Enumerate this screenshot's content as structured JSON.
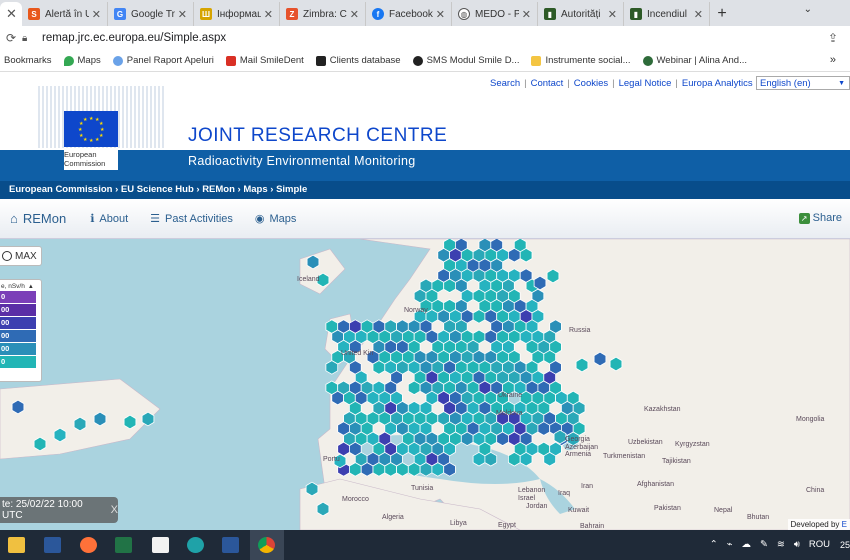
{
  "browser": {
    "tabs": [
      {
        "label": "",
        "favicon": "x-close",
        "color": "#ffffff"
      },
      {
        "label": "Alertă în U",
        "favicon": "s-icon",
        "color": "#e8581c"
      },
      {
        "label": "Google Tra",
        "favicon": "translate-icon",
        "color": "#4285f4"
      },
      {
        "label": "Інформаці",
        "favicon": "trident-icon",
        "color": "#d6a400"
      },
      {
        "label": "Zimbra: Co",
        "favicon": "zimbra-icon",
        "color": "#e6522c"
      },
      {
        "label": "Facebook",
        "favicon": "facebook-icon",
        "color": "#1877f2"
      },
      {
        "label": "MEDO - Pr",
        "favicon": "globe-icon",
        "color": "#555555"
      },
      {
        "label": "Autorități",
        "favicon": "flag-icon",
        "color": "#2d5a27"
      },
      {
        "label": "Incendiul",
        "favicon": "flag-icon",
        "color": "#2d5a27"
      }
    ],
    "new_tab": "+",
    "url": "remap.jrc.ec.europa.eu/Simple.aspx",
    "bookmarks": [
      {
        "label": "Bookmarks",
        "icon": "",
        "color": ""
      },
      {
        "label": "Maps",
        "icon": "maps-icon",
        "color": "#34a853"
      },
      {
        "label": "Panel Raport Apeluri",
        "icon": "cloud-icon",
        "color": "#6aa2e8"
      },
      {
        "label": "Mail SmileDent",
        "icon": "mail-icon",
        "color": "#d93025"
      },
      {
        "label": "Clients database",
        "icon": "y-icon",
        "color": "#222222"
      },
      {
        "label": "SMS Modul Smile D...",
        "icon": "sms-icon",
        "color": "#222222"
      },
      {
        "label": "Instrumente social...",
        "icon": "folder-icon",
        "color": "#f4c542"
      },
      {
        "label": "Webinar | Alina And...",
        "icon": "t-icon",
        "color": "#2e6b3a"
      }
    ],
    "bookmarks_more": "»"
  },
  "header": {
    "links": [
      "Search",
      "Contact",
      "Cookies",
      "Legal Notice",
      "Europa Analytics"
    ],
    "language": "English (en)",
    "ec_line1": "European",
    "ec_line2": "Commission",
    "title": "JOINT RESEARCH CENTRE",
    "subtitle": "Radioactivity Environmental Monitoring",
    "breadcrumb": "European Commission › EU Science Hub › REMon › Maps › Simple"
  },
  "nav": {
    "brand": "REMon",
    "about": "About",
    "past": "Past Activities",
    "maps": "Maps",
    "share": "Share"
  },
  "map": {
    "max_label": "MAX",
    "legend_title": "e, nSv/h",
    "legend_rows": [
      {
        "label": "0",
        "color": "#7b3fb8"
      },
      {
        "label": "00",
        "color": "#5a2ea6"
      },
      {
        "label": "00",
        "color": "#3c3fb0"
      },
      {
        "label": "00",
        "color": "#2f6bb5"
      },
      {
        "label": "00",
        "color": "#2a8fb8"
      },
      {
        "label": "0",
        "color": "#22b5b5"
      }
    ],
    "date_label": "te: 25/02/22 10:00 UTC",
    "date_close": "X",
    "developed_by": "Developed by",
    "developed_by_suffix": "E",
    "labels": {
      "iceland": "Iceland",
      "russia": "Russia",
      "kazakhstan": "Kazakhstan",
      "mongolia": "Mongolia",
      "uzbekistan": "Uzbekistan",
      "kyrgyzstan": "Kyrgyzstan",
      "turkmenistan": "Turkmenistan",
      "tajikistan": "Tajikistan",
      "afghanistan": "Afghanistan",
      "china": "China",
      "pakistan": "Pakistan",
      "nepal": "Nepal",
      "bhutan": "Bhutan",
      "iran": "Iran",
      "iraq": "Iraq",
      "kuwait": "Kuwait",
      "bahrain": "Bahrain",
      "jordan": "Jordan",
      "israel": "Israel",
      "lebanon": "Lebanon",
      "egypt": "Egypt",
      "libya": "Libya",
      "algeria": "Algeria",
      "tunisia": "Tunisia",
      "morocco": "Morocco",
      "portugal": "Portu",
      "ukraine": "Ukraine",
      "moldova": "Moldova",
      "georgia": "Georgia",
      "azerbaijan": "Azerbaijan",
      "armenia": "Armenia",
      "united_kingdom": "United Kin",
      "norway": "Norway"
    }
  },
  "taskbar": {
    "tray_lang": "ROU",
    "clock_partial": "25"
  }
}
